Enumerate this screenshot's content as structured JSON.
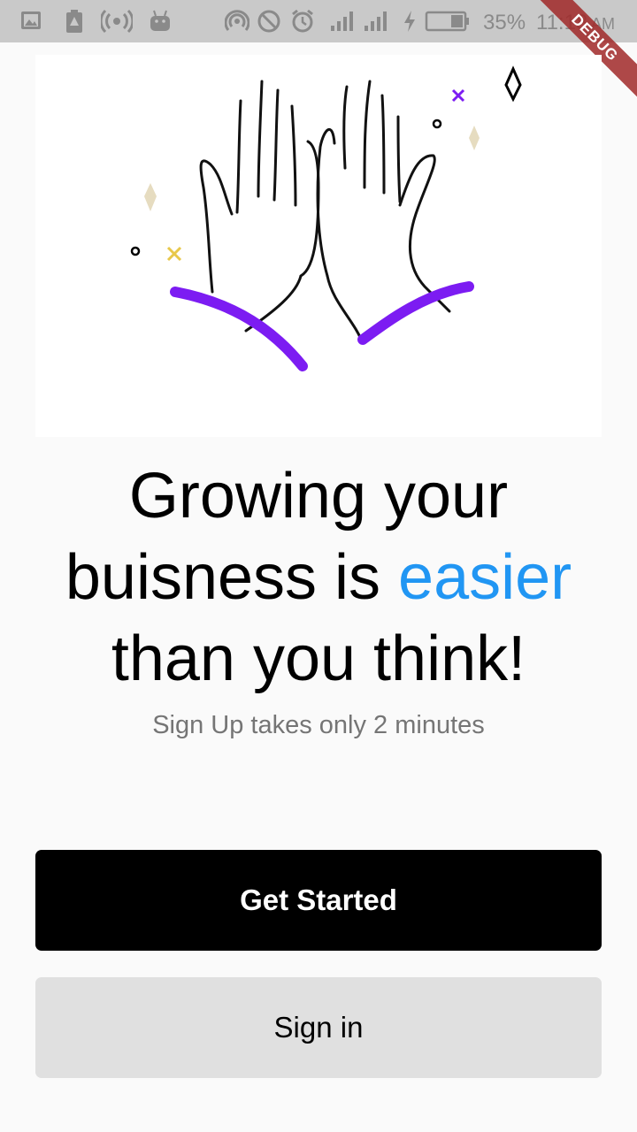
{
  "status_bar": {
    "battery_percent": "35%",
    "time": "11:18",
    "ampm": "AM",
    "icons": [
      "image-icon",
      "battery-alert-icon",
      "broadcast-icon",
      "android-icon",
      "hotspot-icon",
      "do-not-disturb-icon",
      "alarm-icon",
      "signal-icon",
      "signal-icon",
      "charging-icon",
      "battery-icon"
    ]
  },
  "debug_banner": "DEBUG",
  "illustration": {
    "name": "high-five-hands-illustration",
    "accent_color": "#7c1cf2"
  },
  "headline": {
    "part1": "Growing your",
    "part2": "buisness is ",
    "accent": "easier",
    "part3": "than you think!",
    "accent_color": "#2196f3"
  },
  "subtitle": "Sign Up takes only 2 minutes",
  "buttons": {
    "primary_label": "Get Started",
    "secondary_label": "Sign in"
  }
}
